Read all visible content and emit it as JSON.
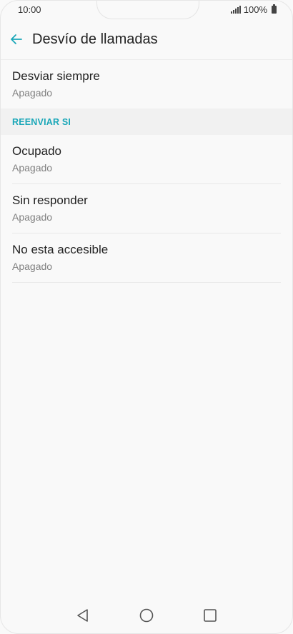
{
  "status_bar": {
    "time": "10:00",
    "battery_text": "100%"
  },
  "app_bar": {
    "title": "Desvío de llamadas",
    "back_icon": "arrow-left-icon",
    "accent_color": "#1aa7b8"
  },
  "top_item": {
    "title": "Desviar siempre",
    "subtitle": "Apagado"
  },
  "section": {
    "header": "REENVIAR SI",
    "items": [
      {
        "title": "Ocupado",
        "subtitle": "Apagado"
      },
      {
        "title": "Sin responder",
        "subtitle": "Apagado"
      },
      {
        "title": "No esta accesible",
        "subtitle": "Apagado"
      }
    ]
  },
  "nav_bar": {
    "back_icon": "triangle-back-icon",
    "home_icon": "circle-home-icon",
    "recents_icon": "square-recents-icon"
  }
}
